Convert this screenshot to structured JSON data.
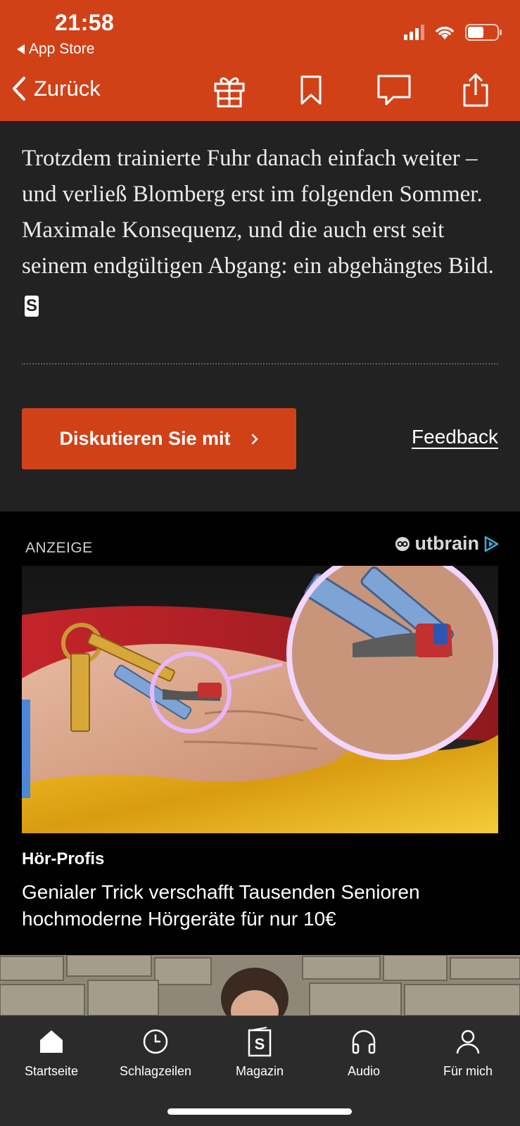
{
  "status_bar": {
    "time": "21:58",
    "back_app": "App Store"
  },
  "nav": {
    "back_label": "Zurück",
    "icons": [
      "gift-icon",
      "bookmark-icon",
      "comment-icon",
      "share-icon"
    ]
  },
  "article": {
    "paragraph": "Trotzdem trainierte Fuhr danach einfach weiter – und verließ Blomberg erst im folgenden Sommer. Maximale Konsequenz, und die auch erst seit seinem endgültigen Abgang: ein abgehängtes Bild.",
    "end_mark": "S"
  },
  "actions": {
    "discuss_label": "Diskutieren Sie mit",
    "feedback_label": "Feedback"
  },
  "ad": {
    "label": "ANZEIGE",
    "network": "Outbrain",
    "source": "Hör-Profis",
    "title": "Genialer Trick verschafft Tausenden Senioren hochmoderne Hörgeräte für nur 10€"
  },
  "tabbar": {
    "items": [
      {
        "label": "Startseite",
        "icon": "home-icon"
      },
      {
        "label": "Schlagzeilen",
        "icon": "clock-icon"
      },
      {
        "label": "Magazin",
        "icon": "magazine-icon"
      },
      {
        "label": "Audio",
        "icon": "headphones-icon"
      },
      {
        "label": "Für mich",
        "icon": "person-icon"
      }
    ]
  },
  "colors": {
    "brand": "#d14118",
    "background": "#222222",
    "ad_background": "#000000"
  }
}
